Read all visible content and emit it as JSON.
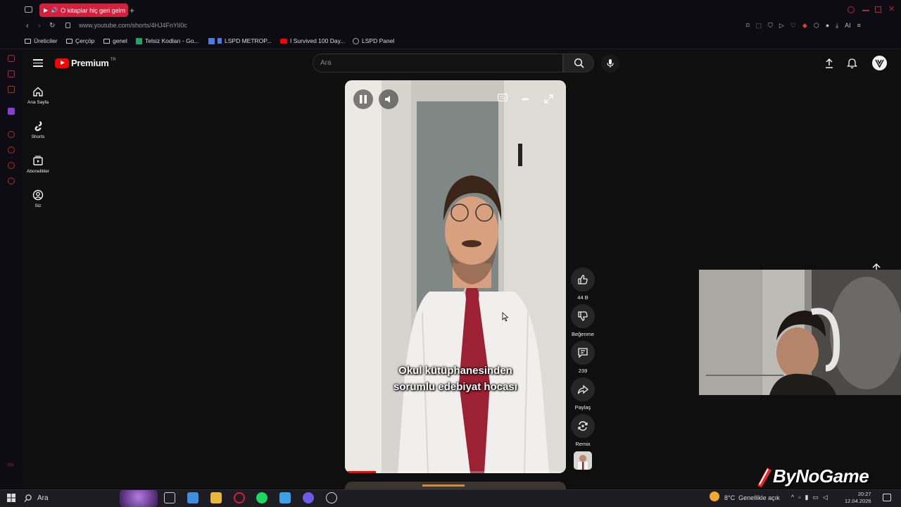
{
  "browser": {
    "tab_title": "O kitaplar hiç geri gelm",
    "url": "www.youtube.com/shorts/4HJ4FnYiI0c",
    "bookmarks": [
      "Üreticiler",
      "Çerçöp",
      "genel",
      "Telsiz Kodları - Go...",
      "LSPD METROP...",
      "I Survived 100 Day...",
      "LSPD Panel"
    ],
    "toolbar_ai": "AI"
  },
  "youtube": {
    "logo_text": "Premium",
    "logo_region": "TR",
    "search_placeholder": "Ara",
    "sidebar": [
      {
        "label": "Ana Sayfa",
        "icon": "home-icon"
      },
      {
        "label": "Shorts",
        "icon": "shorts-icon"
      },
      {
        "label": "Abonelikler",
        "icon": "subscriptions-icon"
      },
      {
        "label": "Siz",
        "icon": "you-icon"
      }
    ],
    "video": {
      "subtitle_line1": "Okul kütüphanesinden",
      "subtitle_line2": "sorumlu edebiyat hocası",
      "progress": 0.14
    },
    "actions": {
      "like_count": "44 B",
      "dislike_label": "Beğenme",
      "comment_count": "239",
      "share_label": "Paylaş",
      "remix_label": "Remix"
    }
  },
  "overlay": {
    "watermark": "ByNoGame"
  },
  "taskbar": {
    "search_placeholder": "Ara",
    "weather_temp": "8°C",
    "weather_desc": "Genellikle açık",
    "time": "20:27",
    "date": "12.04.2026"
  },
  "colors": {
    "accent": "#d61f3c",
    "yt_red": "#ff0000",
    "background": "#0f0f0f"
  }
}
